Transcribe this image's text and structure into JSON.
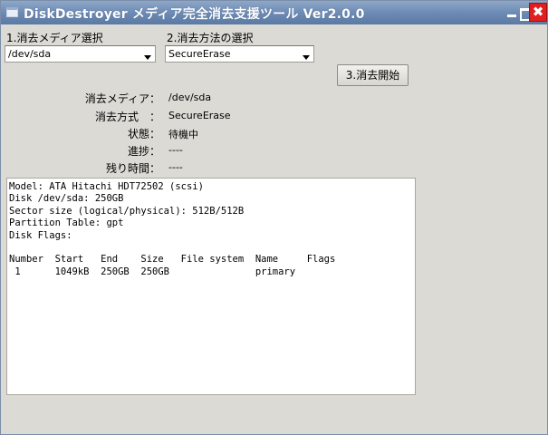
{
  "window": {
    "title": "DiskDestroyer メディア完全消去支援ツール Ver2.0.0",
    "close_glyph": "✖"
  },
  "media_select": {
    "label": "1.消去メディア選択",
    "selected": "/dev/sda"
  },
  "method_select": {
    "label": "2.消去方法の選択",
    "selected": "SecureErase"
  },
  "start_button": {
    "label": "3.消去開始"
  },
  "info": {
    "media_key": "消去メディア：",
    "media_value": "/dev/sda",
    "method_key": "消去方式　：",
    "method_value": "SecureErase",
    "state_key": "状態：",
    "state_value": "待機中",
    "progress_key": "進捗：",
    "progress_value": "----",
    "remaining_key": "残り時間：",
    "remaining_value": "----"
  },
  "log": {
    "text": "Model: ATA Hitachi HDT72502 (scsi)\nDisk /dev/sda: 250GB\nSector size (logical/physical): 512B/512B\nPartition Table: gpt\nDisk Flags:\n\nNumber  Start   End    Size   File system  Name     Flags\n 1      1049kB  250GB  250GB               primary"
  },
  "colors": {
    "titlebar": "#6d8bb4",
    "close": "#e02020",
    "window_bg": "#dcdad5"
  }
}
